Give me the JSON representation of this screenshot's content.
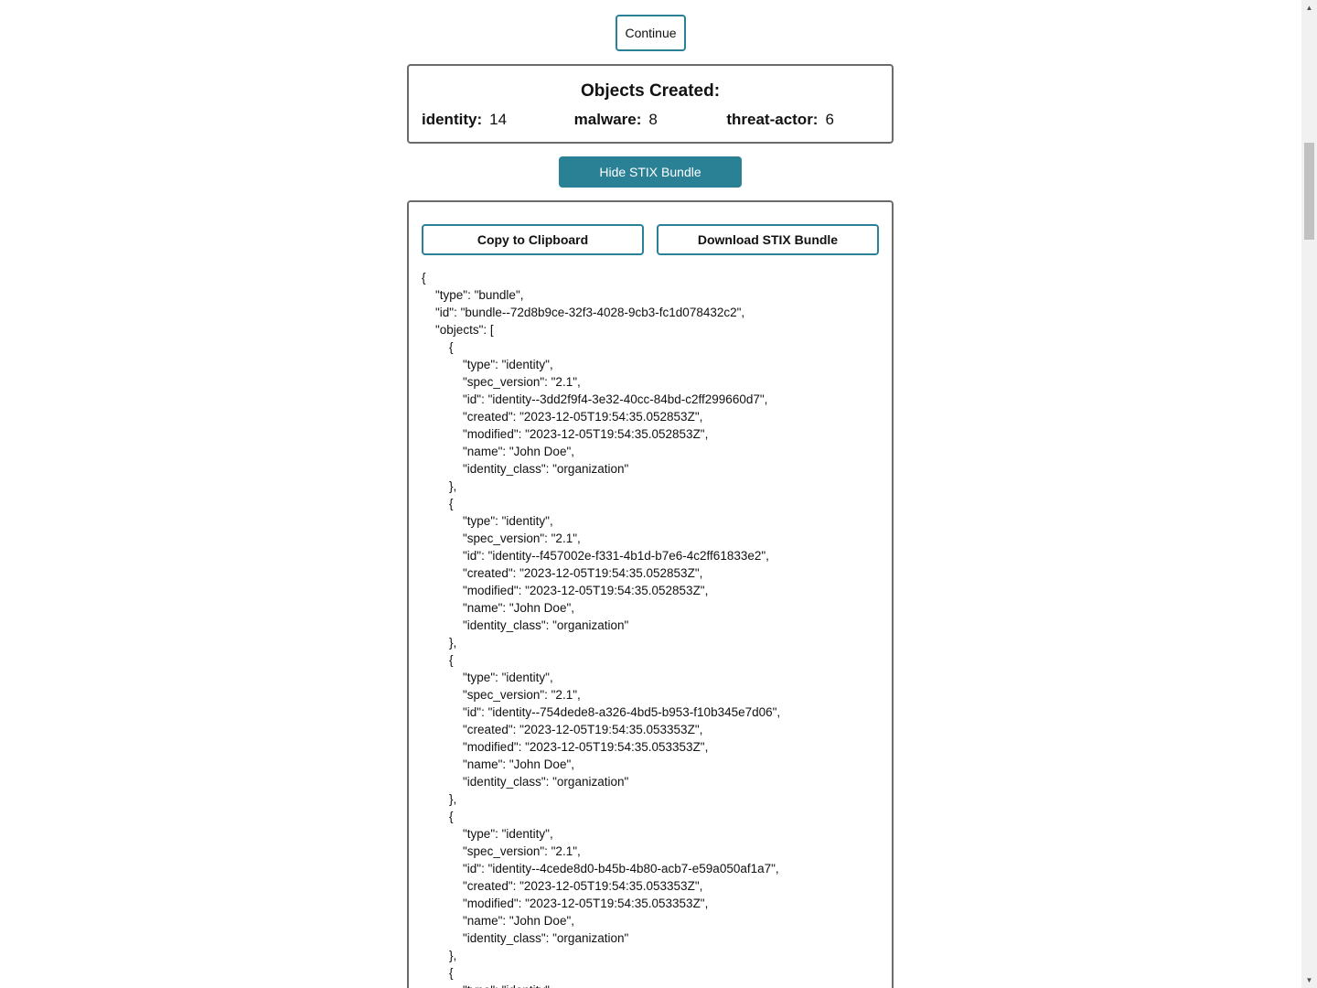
{
  "continue_label": "Continue",
  "objects_panel": {
    "title": "Objects Created:",
    "counts": [
      {
        "key": "identity:",
        "value": "14"
      },
      {
        "key": "malware:",
        "value": "8"
      },
      {
        "key": "threat-actor:",
        "value": "6"
      }
    ]
  },
  "hide_bundle_label": "Hide STIX Bundle",
  "bundle_panel": {
    "copy_label": "Copy to Clipboard",
    "download_label": "Download STIX Bundle",
    "json_text": "{\n    \"type\": \"bundle\",\n    \"id\": \"bundle--72d8b9ce-32f3-4028-9cb3-fc1d078432c2\",\n    \"objects\": [\n        {\n            \"type\": \"identity\",\n            \"spec_version\": \"2.1\",\n            \"id\": \"identity--3dd2f9f4-3e32-40cc-84bd-c2ff299660d7\",\n            \"created\": \"2023-12-05T19:54:35.052853Z\",\n            \"modified\": \"2023-12-05T19:54:35.052853Z\",\n            \"name\": \"John Doe\",\n            \"identity_class\": \"organization\"\n        },\n        {\n            \"type\": \"identity\",\n            \"spec_version\": \"2.1\",\n            \"id\": \"identity--f457002e-f331-4b1d-b7e6-4c2ff61833e2\",\n            \"created\": \"2023-12-05T19:54:35.052853Z\",\n            \"modified\": \"2023-12-05T19:54:35.052853Z\",\n            \"name\": \"John Doe\",\n            \"identity_class\": \"organization\"\n        },\n        {\n            \"type\": \"identity\",\n            \"spec_version\": \"2.1\",\n            \"id\": \"identity--754dede8-a326-4bd5-b953-f10b345e7d06\",\n            \"created\": \"2023-12-05T19:54:35.053353Z\",\n            \"modified\": \"2023-12-05T19:54:35.053353Z\",\n            \"name\": \"John Doe\",\n            \"identity_class\": \"organization\"\n        },\n        {\n            \"type\": \"identity\",\n            \"spec_version\": \"2.1\",\n            \"id\": \"identity--4cede8d0-b45b-4b80-acb7-e59a050af1a7\",\n            \"created\": \"2023-12-05T19:54:35.053353Z\",\n            \"modified\": \"2023-12-05T19:54:35.053353Z\",\n            \"name\": \"John Doe\",\n            \"identity_class\": \"organization\"\n        },\n        {\n            \"type\": \"identity\","
  },
  "scrollbar": {
    "up_icon": "chevron-up-icon",
    "down_icon": "chevron-down-icon"
  },
  "colors": {
    "accent": "#2a8196",
    "panel_border": "#6b6b6b",
    "scroll_track": "#f1f1f1",
    "scroll_thumb": "#c1c1c1"
  }
}
